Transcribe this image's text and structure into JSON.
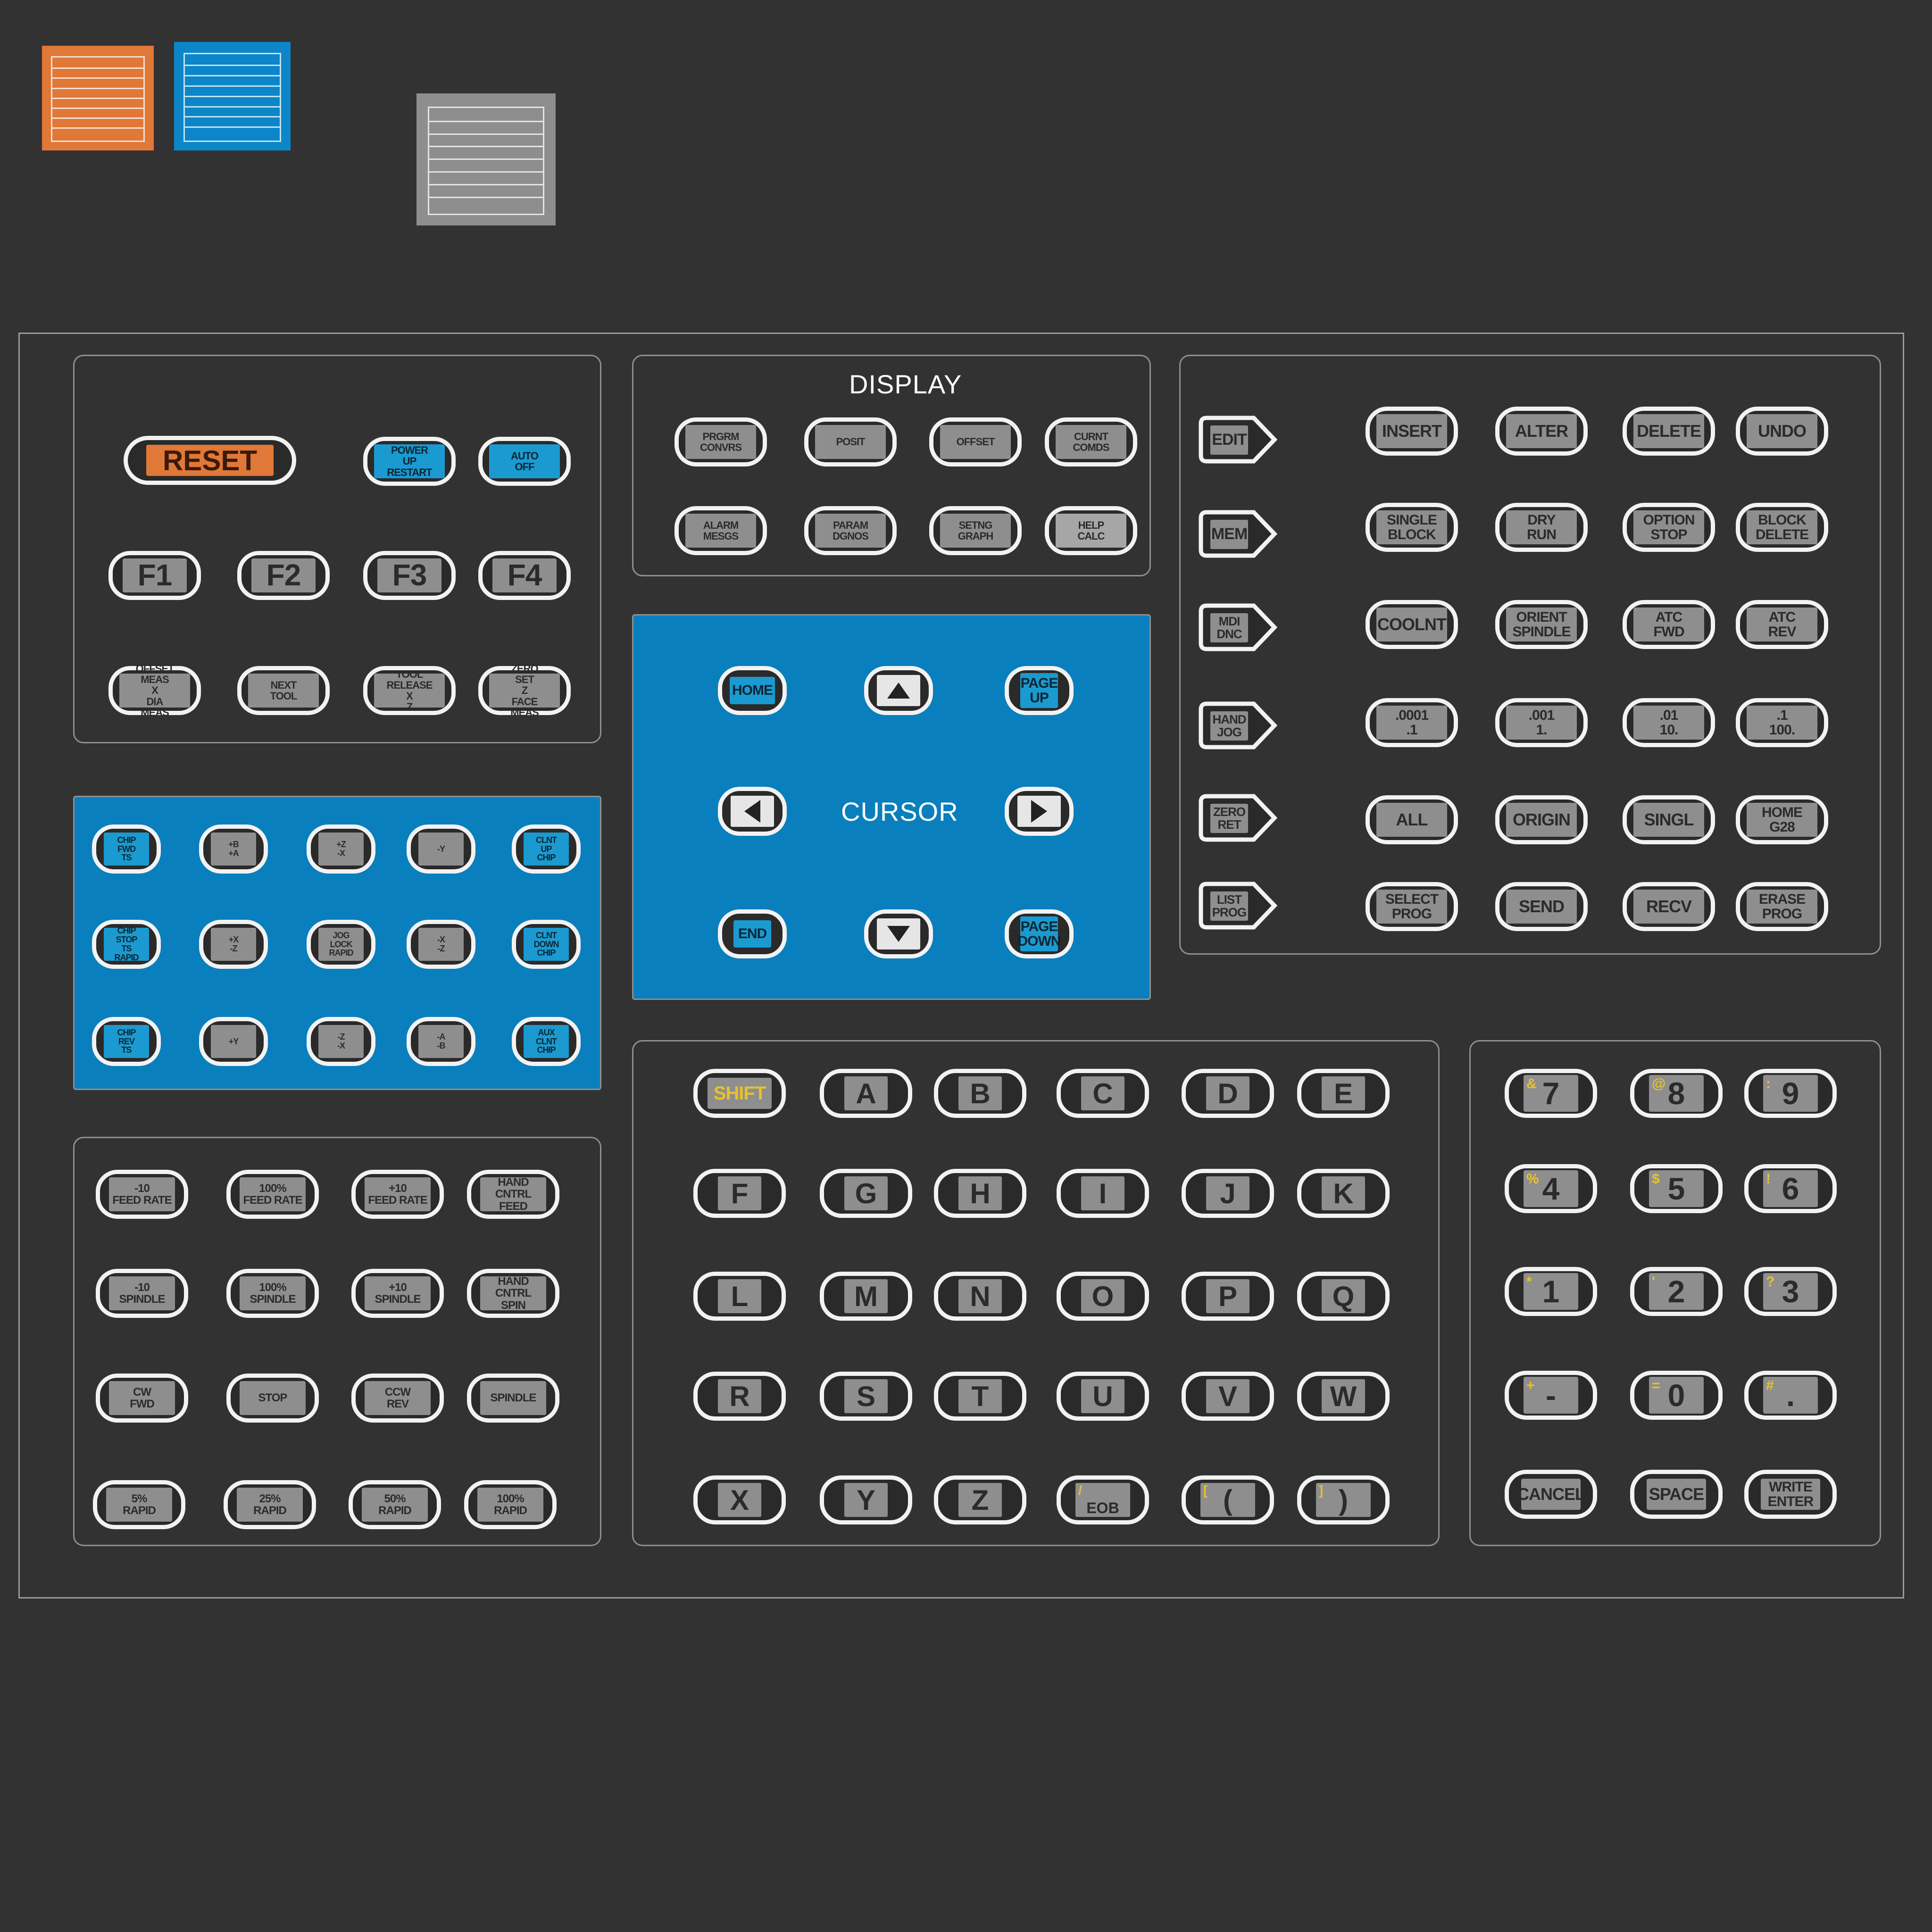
{
  "swatches": {
    "orange": "#e07838",
    "blue": "#0c86c8",
    "gray": "#8e8e8e"
  },
  "control_group": {
    "reset": "RESET",
    "power_up": [
      "POWER",
      "UP",
      "RESTART"
    ],
    "auto_off": [
      "AUTO",
      "OFF"
    ],
    "f_keys": [
      "F1",
      "F2",
      "F3",
      "F4"
    ],
    "row3": [
      [
        "OFFSET",
        "MEAS",
        "X",
        "DIA",
        "MEAS"
      ],
      [
        "NEXT",
        "TOOL"
      ],
      [
        "TOOL",
        "RELEASE",
        "X",
        "Z"
      ],
      [
        "ZERO",
        "SET",
        "Z",
        "FACE",
        "MEAS"
      ]
    ]
  },
  "display": {
    "title": "DISPLAY",
    "keys": [
      [
        "PRGRM",
        "CONVRS"
      ],
      [
        "POSIT"
      ],
      [
        "OFFSET"
      ],
      [
        "CURNT",
        "COMDS"
      ],
      [
        "ALARM",
        "MESGS"
      ],
      [
        "PARAM",
        "DGNOS"
      ],
      [
        "SETNG",
        "GRAPH"
      ],
      [
        "HELP",
        "CALC"
      ]
    ]
  },
  "cursor": {
    "title": "CURSOR",
    "home": "HOME",
    "page_up": [
      "PAGE",
      "UP"
    ],
    "end": "END",
    "page_down": [
      "PAGE",
      "DOWN"
    ]
  },
  "modes": {
    "tags": [
      [
        "EDIT"
      ],
      [
        "MEM"
      ],
      [
        "MDI",
        "DNC"
      ],
      [
        "HAND",
        "JOG"
      ],
      [
        "ZERO",
        "RET"
      ],
      [
        "LIST",
        "PROG"
      ]
    ],
    "rows": [
      [
        [
          "INSERT"
        ],
        [
          "ALTER"
        ],
        [
          "DELETE"
        ],
        [
          "UNDO"
        ]
      ],
      [
        [
          "SINGLE",
          "BLOCK"
        ],
        [
          "DRY",
          "RUN"
        ],
        [
          "OPTION",
          "STOP"
        ],
        [
          "BLOCK",
          "DELETE"
        ]
      ],
      [
        [
          "COOLNT"
        ],
        [
          "ORIENT",
          "SPINDLE"
        ],
        [
          "ATC",
          "FWD"
        ],
        [
          "ATC",
          "REV"
        ]
      ],
      [
        [
          ".0001",
          ".1"
        ],
        [
          ".001",
          "1."
        ],
        [
          ".01",
          "10."
        ],
        [
          ".1",
          "100."
        ]
      ],
      [
        [
          "ALL"
        ],
        [
          "ORIGIN"
        ],
        [
          "SINGL"
        ],
        [
          "HOME",
          "G28"
        ]
      ],
      [
        [
          "SELECT",
          "PROG"
        ],
        [
          "SEND"
        ],
        [
          "RECV"
        ],
        [
          "ERASE",
          "PROG"
        ]
      ]
    ]
  },
  "jog": {
    "keys": [
      [
        "CHIP",
        "FWD",
        "TS"
      ],
      [
        "+B",
        "+A"
      ],
      [
        "+Z",
        "-X"
      ],
      [
        "-Y"
      ],
      [
        "CLNT",
        "UP",
        "CHIP"
      ],
      [
        "CHIP",
        "STOP",
        "TS",
        "RAPID"
      ],
      [
        "+X",
        "-Z"
      ],
      [
        "JOG",
        "LOCK",
        "RAPID"
      ],
      [
        "-X",
        "-Z"
      ],
      [
        "CLNT",
        "DOWN",
        "CHIP"
      ],
      [
        "CHIP",
        "REV",
        "TS"
      ],
      [
        "+Y"
      ],
      [
        "-Z",
        "-X"
      ],
      [
        "-A",
        "-B"
      ],
      [
        "AUX",
        "CLNT",
        "CHIP"
      ]
    ]
  },
  "overrides": {
    "rows": [
      [
        [
          "-10",
          "FEED RATE"
        ],
        [
          "100%",
          "FEED RATE"
        ],
        [
          "+10",
          "FEED RATE"
        ],
        [
          "HAND",
          "CNTRL",
          "FEED"
        ]
      ],
      [
        [
          "-10",
          "SPINDLE"
        ],
        [
          "100%",
          "SPINDLE"
        ],
        [
          "+10",
          "SPINDLE"
        ],
        [
          "HAND",
          "CNTRL",
          "SPIN"
        ]
      ],
      [
        [
          "CW",
          "FWD"
        ],
        [
          "STOP"
        ],
        [
          "CCW",
          "REV"
        ],
        [
          "SPINDLE"
        ]
      ],
      [
        [
          "5%",
          "RAPID"
        ],
        [
          "25%",
          "RAPID"
        ],
        [
          "50%",
          "RAPID"
        ],
        [
          "100%",
          "RAPID"
        ]
      ]
    ]
  },
  "alpha": {
    "shift": "SHIFT",
    "rows": [
      [
        "A",
        "B",
        "C",
        "D",
        "E"
      ],
      [
        "F",
        "G",
        "H",
        "I",
        "J",
        "K"
      ],
      [
        "L",
        "M",
        "N",
        "O",
        "P",
        "Q"
      ],
      [
        "R",
        "S",
        "T",
        "U",
        "V",
        "W"
      ],
      [
        "X",
        "Y",
        "Z",
        "EOB",
        "(",
        ")"
      ]
    ],
    "hints": {
      "EOB": "/",
      "(": "[",
      ")": "]"
    }
  },
  "numpad": {
    "rows": [
      [
        {
          "main": "7",
          "hint": "&"
        },
        {
          "main": "8",
          "hint": "@"
        },
        {
          "main": "9",
          "hint": ":"
        }
      ],
      [
        {
          "main": "4",
          "hint": "%"
        },
        {
          "main": "5",
          "hint": "$"
        },
        {
          "main": "6",
          "hint": "!"
        }
      ],
      [
        {
          "main": "1",
          "hint": "*"
        },
        {
          "main": "2",
          "hint": "'"
        },
        {
          "main": "3",
          "hint": "?"
        }
      ],
      [
        {
          "main": "-",
          "hint": "+"
        },
        {
          "main": "0",
          "hint": "="
        },
        {
          "main": ".",
          "hint": "#"
        }
      ]
    ],
    "bottom": [
      [
        "CANCEL"
      ],
      [
        "SPACE"
      ],
      [
        "WRITE",
        "ENTER"
      ]
    ]
  }
}
